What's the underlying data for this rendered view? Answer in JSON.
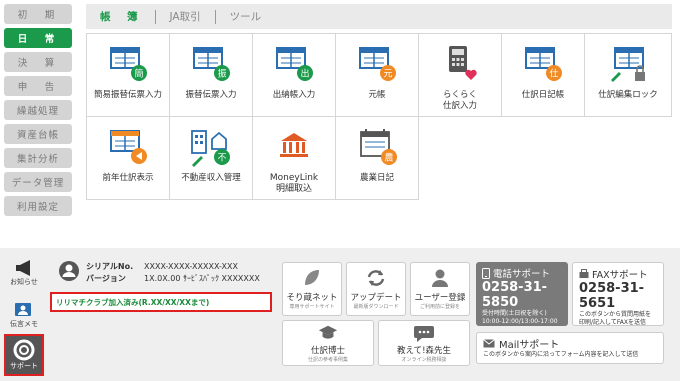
{
  "nav": {
    "items": [
      {
        "label": "初　期"
      },
      {
        "label": "日　常"
      },
      {
        "label": "決　算"
      },
      {
        "label": "申　告"
      },
      {
        "label": "繰越処理"
      },
      {
        "label": "資産台帳"
      },
      {
        "label": "集計分析"
      },
      {
        "label": "データ管理"
      },
      {
        "label": "利用設定"
      }
    ]
  },
  "tabs": [
    {
      "label": "帳　簿"
    },
    {
      "label": "JA取引"
    },
    {
      "label": "ツール"
    }
  ],
  "functions": [
    {
      "label": "簡易振替伝票入力",
      "badge": "簡",
      "badge_color": "#1a9a4a"
    },
    {
      "label": "振替伝票入力",
      "badge": "振",
      "badge_color": "#1a9a4a"
    },
    {
      "label": "出納帳入力",
      "badge": "出",
      "badge_color": "#1a9a4a"
    },
    {
      "label": "元帳",
      "badge": "元",
      "badge_color": "#f08a24"
    },
    {
      "label": "らくらく\n仕訳入力",
      "badge": "",
      "badge_color": "#e0305a"
    },
    {
      "label": "仕訳日記帳",
      "badge": "仕",
      "badge_color": "#f08a24"
    },
    {
      "label": "仕訳編集ロック",
      "badge": "",
      "badge_color": "#666666"
    },
    {
      "label": "前年仕訳表示",
      "badge": "",
      "badge_color": "#f08a24"
    },
    {
      "label": "不動産収入管理",
      "badge": "不",
      "badge_color": "#1a9a4a"
    },
    {
      "label": "MoneyLink\n明細取込",
      "badge": "",
      "badge_color": "#e05a24"
    },
    {
      "label": "農業日記",
      "badge": "農",
      "badge_color": "#f08a24"
    }
  ],
  "side": {
    "notice": "お知らせ",
    "memo": "伝言メモ",
    "support": "サポート"
  },
  "serial": {
    "no_label": "シリアルNo.",
    "no_value": "XXXX-XXXX-XXXXX-XXX",
    "ver_label": "バージョン",
    "ver_value": "1X.0X.00 ｻｰﾋﾞｽﾊﾟｯｸ XXXXXXX"
  },
  "remachi": "リリマチクラブ加入済み(R.XX/XX/XXまで)",
  "tiles": {
    "soro_title": "そり蔵ネット",
    "soro_sub": "専用サポートサイト",
    "update_title": "アップデート",
    "update_sub": "最新版ダウンロード",
    "user_title": "ユーザー登録",
    "user_sub": "ご利用前に登録を",
    "hakase_title": "仕訳博士",
    "hakase_sub": "仕訳の参考事例集",
    "mori_title": "教えて!森先生",
    "mori_sub": "オンライン税務相談"
  },
  "phone": {
    "title": "電話サポート",
    "number": "0258-31-5850",
    "hours1": "受付時間(土日祝を除く)",
    "hours2": "10:00-12:00/13:00-17:00"
  },
  "fax": {
    "title": "FAXサポート",
    "number": "0258-31-5651",
    "desc1": "このボタンから質問用紙を",
    "desc2": "印刷/記入してFAXを送信"
  },
  "mail": {
    "title": "Mailサポート",
    "desc": "このボタンから案内に沿ってフォーム内容を記入して送信"
  }
}
